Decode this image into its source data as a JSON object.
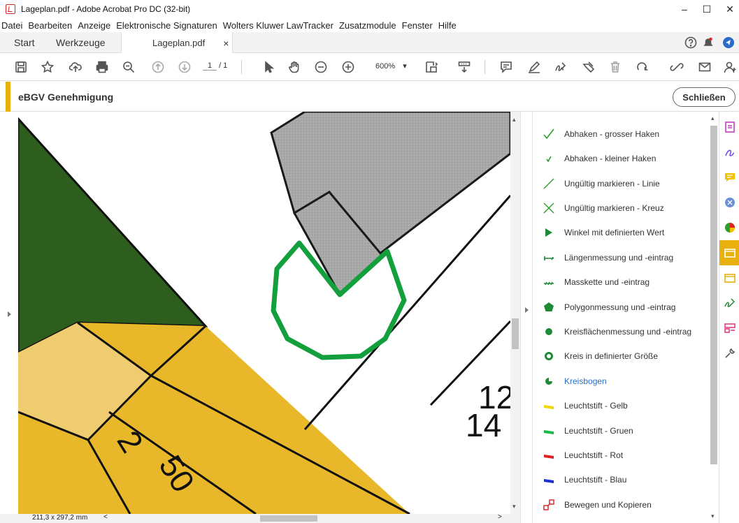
{
  "window": {
    "title": "Lageplan.pdf - Adobe Acrobat Pro DC (32-bit)",
    "controls": [
      "minimize-icon",
      "maximize-icon",
      "close-icon"
    ]
  },
  "menu": [
    "Datei",
    "Bearbeiten",
    "Anzeige",
    "Elektronische Signaturen",
    "Wolters Kluwer LawTracker",
    "Zusatzmodule",
    "Fenster",
    "Hilfe"
  ],
  "tabs": {
    "home": "Start",
    "tools": "Werkzeuge",
    "document": "Lageplan.pdf",
    "close_glyph": "×"
  },
  "toolbar": {
    "page_current": "1",
    "page_total": "/ 1",
    "zoom": "600%",
    "zoom_arrow": "▾"
  },
  "header": {
    "title": "eBGV Genehmigung",
    "close_label": "Schließen"
  },
  "status": {
    "page_size": "211,3 x 297,2 mm",
    "scroll_left_glyph": "<",
    "scroll_right_glyph": ">"
  },
  "document_text": {
    "num1": "12",
    "num2": "14",
    "num3": "50",
    "num4": "2"
  },
  "panel_items": [
    {
      "label": "Abhaken - grosser Haken",
      "icon": "large-check-icon",
      "color": "#2aa02a"
    },
    {
      "label": "Abhaken - kleiner Haken",
      "icon": "small-check-icon",
      "color": "#2aa02a"
    },
    {
      "label": "Ungültig markieren - Linie",
      "icon": "line-icon",
      "color": "#2aa02a"
    },
    {
      "label": "Ungültig markieren - Kreuz",
      "icon": "cross-icon",
      "color": "#2aa02a"
    },
    {
      "label": "Winkel mit definierten Wert",
      "icon": "angle-icon",
      "color": "#1f8a35"
    },
    {
      "label": "Längenmessung und -eintrag",
      "icon": "length-measure-icon",
      "color": "#1f8a35"
    },
    {
      "label": "Masskette und -eintrag",
      "icon": "dimension-chain-icon",
      "color": "#1f8a35"
    },
    {
      "label": "Polygonmessung und -eintrag",
      "icon": "polygon-icon",
      "color": "#1f8a35"
    },
    {
      "label": "Kreisflächenmessung und -eintrag",
      "icon": "circle-area-icon",
      "color": "#1f8a35"
    },
    {
      "label": "Kreis in definierter Größe",
      "icon": "circle-defined-icon",
      "color": "#1f8a35"
    },
    {
      "label": "Kreisbogen",
      "icon": "arc-icon",
      "color": "#1f8a35"
    },
    {
      "label": "Leuchtstift - Gelb",
      "icon": "highlighter-yellow-icon",
      "color": "#f2d600"
    },
    {
      "label": "Leuchtstift - Gruen",
      "icon": "highlighter-green-icon",
      "color": "#16b84a"
    },
    {
      "label": "Leuchtstift - Rot",
      "icon": "highlighter-red-icon",
      "color": "#e02020"
    },
    {
      "label": "Leuchtstift - Blau",
      "icon": "highlighter-blue-icon",
      "color": "#1a2fd0"
    },
    {
      "label": "Bewegen und Kopieren",
      "icon": "move-copy-icon",
      "color": "#d62020"
    }
  ],
  "colors": {
    "accent": "#e8b10e",
    "annotation_green": "#13a03c",
    "plot_green": "#2e5e1e",
    "plot_yellow": "#e9b72a",
    "building_gray": "#a9a9a9"
  }
}
